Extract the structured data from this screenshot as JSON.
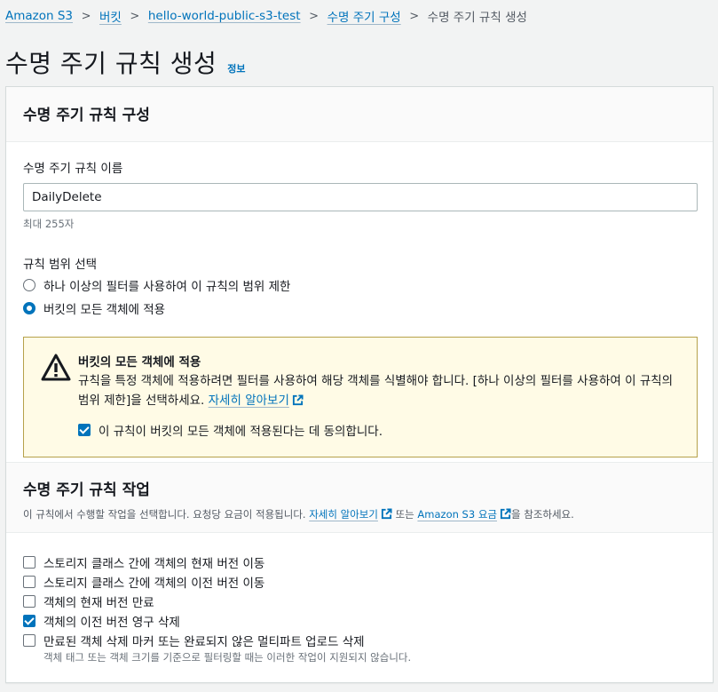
{
  "breadcrumb": {
    "items": [
      "Amazon S3",
      "버킷",
      "hello-world-public-s3-test",
      "수명 주기 구성"
    ],
    "current": "수명 주기 규칙 생성"
  },
  "page": {
    "title": "수명 주기 규칙 생성",
    "info_link": "정보"
  },
  "config": {
    "header": "수명 주기 규칙 구성",
    "name_label": "수명 주기 규칙 이름",
    "name_value": "DailyDelete",
    "name_hint": "최대 255자",
    "scope_label": "규칙 범위 선택",
    "scope_options": [
      {
        "label": "하나 이상의 필터를 사용하여 이 규칙의 범위 제한",
        "selected": false
      },
      {
        "label": "버킷의 모든 객체에 적용",
        "selected": true
      }
    ]
  },
  "alert": {
    "title": "버킷의 모든 객체에 적용",
    "text": "규칙을 특정 객체에 적용하려면 필터를 사용하여 해당 객체를 식별해야 합니다. [하나 이상의 필터를 사용하여 이 규칙의 범위 제한]을 선택하세요.",
    "learn_more": "자세히 알아보기",
    "ack_label": "이 규칙이 버킷의 모든 객체에 적용된다는 데 동의합니다.",
    "ack_checked": true
  },
  "actions": {
    "header": "수명 주기 규칙 작업",
    "desc_prefix": "이 규칙에서 수행할 작업을 선택합니다. 요청당 요금이 적용됩니다.",
    "learn_more": "자세히 알아보기",
    "desc_mid": "또는",
    "pricing_link": "Amazon S3 요금",
    "desc_suffix": "을 참조하세요.",
    "items": [
      {
        "label": "스토리지 클래스 간에 객체의 현재 버전 이동",
        "checked": false
      },
      {
        "label": "스토리지 클래스 간에 객체의 이전 버전 이동",
        "checked": false
      },
      {
        "label": "객체의 현재 버전 만료",
        "checked": false
      },
      {
        "label": "객체의 이전 버전 영구 삭제",
        "checked": true
      },
      {
        "label": "만료된 객체 삭제 마커 또는 완료되지 않은 멀티파트 업로드 삭제",
        "checked": false
      }
    ],
    "note": "객체 태그 또는 객체 크기를 기준으로 필터링할 때는 이러한 작업이 지원되지 않습니다."
  },
  "colors": {
    "accent": "#0073bb",
    "warning_bg": "#fffbe6",
    "warning_border": "#b6a14b"
  }
}
